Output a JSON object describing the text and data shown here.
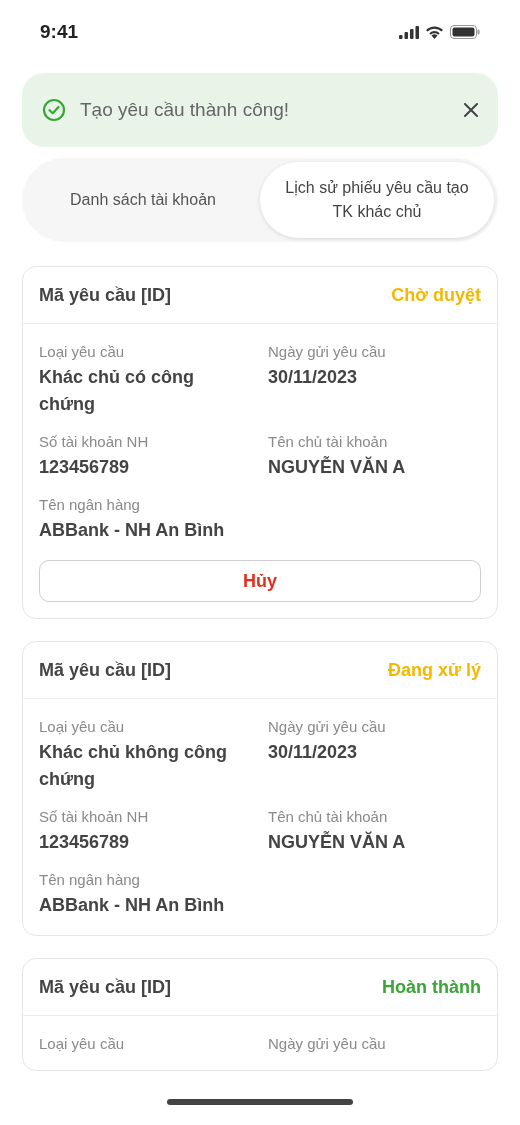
{
  "status_bar": {
    "time": "9:41"
  },
  "toast": {
    "message": "Tạo yêu cầu thành công!"
  },
  "tabs": [
    {
      "label": "Danh sách tài khoản",
      "selected": false
    },
    {
      "label": "Lịch sử phiếu yêu cầu tạo TK khác chủ",
      "selected": true
    }
  ],
  "requests": [
    {
      "title": "Mã yêu cầu [ID]",
      "status": "Chờ duyệt",
      "color": "#f5b800",
      "fields": [
        {
          "label": "Loại yêu cầu",
          "value": "Khác chủ có công chứng"
        },
        {
          "label": "Ngày gửi yêu cầu",
          "value": "30/11/2023"
        },
        {
          "label": "Số tài khoản NH",
          "value": "123456789"
        },
        {
          "label": "Tên chủ tài khoản",
          "value": "NGUYỄN VĂN A"
        },
        {
          "label": "Tên ngân hàng",
          "value": "ABBank - NH An Bình"
        }
      ],
      "cancel_button": "Hủy"
    },
    {
      "title": "Mã yêu cầu [ID]",
      "status": "Đang xử lý",
      "color": "#f5b800",
      "fields": [
        {
          "label": "Loại yêu cầu",
          "value": "Khác chủ không công chứng"
        },
        {
          "label": "Ngày gửi yêu cầu",
          "value": "30/11/2023"
        },
        {
          "label": "Số tài khoản NH",
          "value": "123456789"
        },
        {
          "label": "Tên chủ tài khoản",
          "value": "NGUYỄN VĂN A"
        },
        {
          "label": "Tên ngân hàng",
          "value": "ABBank - NH An Bình"
        }
      ]
    },
    {
      "title": "Mã yêu cầu [ID]",
      "status": "Hoàn thành",
      "color": "#3aa637",
      "fields": [
        {
          "label": "Loại yêu cầu"
        },
        {
          "label": "Ngày gửi yêu cầu"
        }
      ]
    }
  ]
}
